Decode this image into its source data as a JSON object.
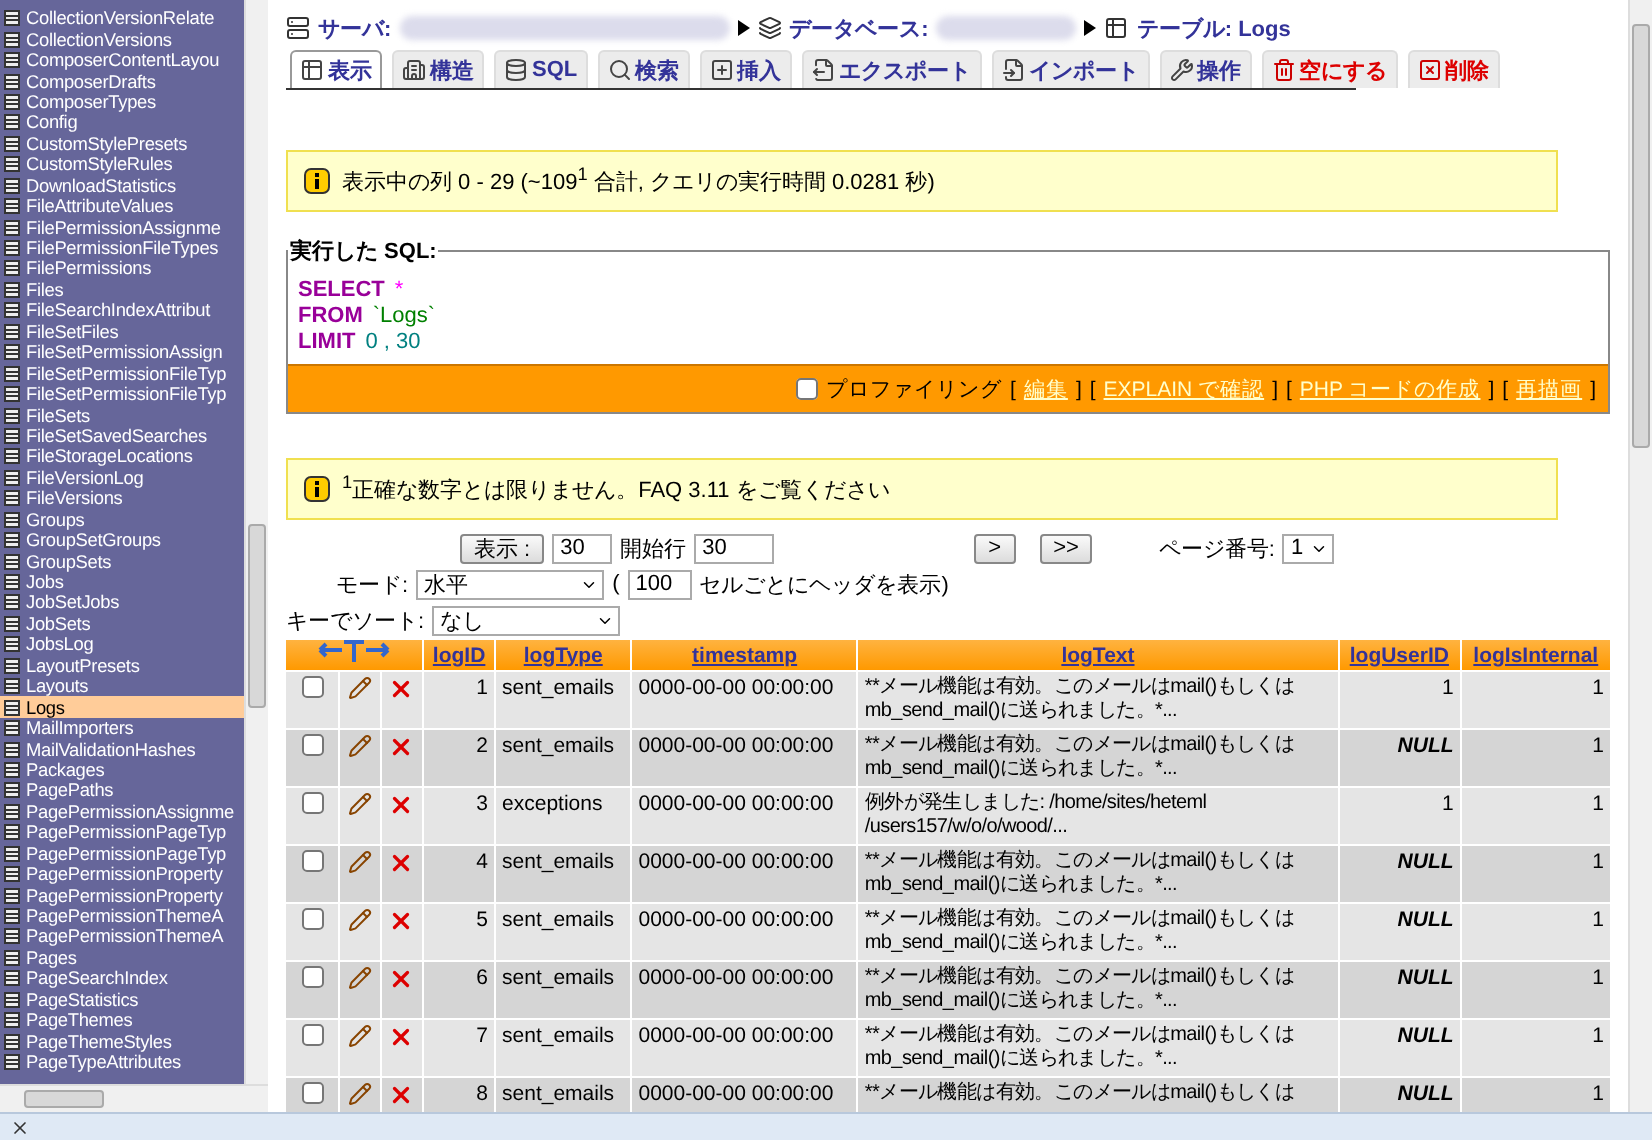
{
  "sidebar": {
    "items": [
      {
        "label": "CollectionVersionRelate",
        "selected": false
      },
      {
        "label": "CollectionVersions",
        "selected": false
      },
      {
        "label": "ComposerContentLayou",
        "selected": false
      },
      {
        "label": "ComposerDrafts",
        "selected": false
      },
      {
        "label": "ComposerTypes",
        "selected": false
      },
      {
        "label": "Config",
        "selected": false
      },
      {
        "label": "CustomStylePresets",
        "selected": false
      },
      {
        "label": "CustomStyleRules",
        "selected": false
      },
      {
        "label": "DownloadStatistics",
        "selected": false
      },
      {
        "label": "FileAttributeValues",
        "selected": false
      },
      {
        "label": "FilePermissionAssignme",
        "selected": false
      },
      {
        "label": "FilePermissionFileTypes",
        "selected": false
      },
      {
        "label": "FilePermissions",
        "selected": false
      },
      {
        "label": "Files",
        "selected": false
      },
      {
        "label": "FileSearchIndexAttribut",
        "selected": false
      },
      {
        "label": "FileSetFiles",
        "selected": false
      },
      {
        "label": "FileSetPermissionAssign",
        "selected": false
      },
      {
        "label": "FileSetPermissionFileTyp",
        "selected": false
      },
      {
        "label": "FileSetPermissionFileTyp",
        "selected": false
      },
      {
        "label": "FileSets",
        "selected": false
      },
      {
        "label": "FileSetSavedSearches",
        "selected": false
      },
      {
        "label": "FileStorageLocations",
        "selected": false
      },
      {
        "label": "FileVersionLog",
        "selected": false
      },
      {
        "label": "FileVersions",
        "selected": false
      },
      {
        "label": "Groups",
        "selected": false
      },
      {
        "label": "GroupSetGroups",
        "selected": false
      },
      {
        "label": "GroupSets",
        "selected": false
      },
      {
        "label": "Jobs",
        "selected": false
      },
      {
        "label": "JobSetJobs",
        "selected": false
      },
      {
        "label": "JobSets",
        "selected": false
      },
      {
        "label": "JobsLog",
        "selected": false
      },
      {
        "label": "LayoutPresets",
        "selected": false
      },
      {
        "label": "Layouts",
        "selected": false
      },
      {
        "label": "Logs",
        "selected": true
      },
      {
        "label": "MailImporters",
        "selected": false
      },
      {
        "label": "MailValidationHashes",
        "selected": false
      },
      {
        "label": "Packages",
        "selected": false
      },
      {
        "label": "PagePaths",
        "selected": false
      },
      {
        "label": "PagePermissionAssignme",
        "selected": false
      },
      {
        "label": "PagePermissionPageTyp",
        "selected": false
      },
      {
        "label": "PagePermissionPageTyp",
        "selected": false
      },
      {
        "label": "PagePermissionProperty",
        "selected": false
      },
      {
        "label": "PagePermissionProperty",
        "selected": false
      },
      {
        "label": "PagePermissionThemeA",
        "selected": false
      },
      {
        "label": "PagePermissionThemeA",
        "selected": false
      },
      {
        "label": "Pages",
        "selected": false
      },
      {
        "label": "PageSearchIndex",
        "selected": false
      },
      {
        "label": "PageStatistics",
        "selected": false
      },
      {
        "label": "PageThemes",
        "selected": false
      },
      {
        "label": "PageThemeStyles",
        "selected": false
      },
      {
        "label": "PageTypeAttributes",
        "selected": false
      }
    ]
  },
  "breadcrumb": [
    {
      "kind": "server",
      "label": "サーバ:",
      "redacted": true
    },
    {
      "kind": "database",
      "label": "データベース:",
      "redacted": true
    },
    {
      "kind": "table",
      "label": "テーブル:",
      "value": "Logs"
    }
  ],
  "tabs": [
    {
      "label": "表示",
      "selected": true,
      "kind": "normal"
    },
    {
      "label": "構造",
      "selected": false,
      "kind": "normal"
    },
    {
      "label": "SQL",
      "selected": false,
      "kind": "normal"
    },
    {
      "label": "検索",
      "selected": false,
      "kind": "normal"
    },
    {
      "label": "挿入",
      "selected": false,
      "kind": "normal"
    },
    {
      "label": "エクスポート",
      "selected": false,
      "kind": "normal"
    },
    {
      "label": "インポート",
      "selected": false,
      "kind": "normal"
    },
    {
      "label": "操作",
      "selected": false,
      "kind": "normal"
    },
    {
      "label": "空にする",
      "selected": false,
      "kind": "danger"
    },
    {
      "label": "削除",
      "selected": false,
      "kind": "danger"
    }
  ],
  "result_notice": "表示中の列 0 - 29 (~109$^{1}$ 合計, クエリの実行時間 0.0281 秒)",
  "sql": {
    "legend": "実行した SQL:",
    "lines": [
      [
        {
          "text": "SELECT",
          "kind": "keyword"
        },
        {
          "text": "*",
          "kind": "operator"
        }
      ],
      [
        {
          "text": "FROM",
          "kind": "keyword"
        },
        {
          "text": "`Logs`",
          "kind": "identifier"
        }
      ],
      [
        {
          "text": "LIMIT",
          "kind": "keyword"
        },
        {
          "text": "0 , 30",
          "kind": "number"
        }
      ]
    ],
    "profiling": {
      "label": "プロファイリング",
      "checked": false
    },
    "links": [
      {
        "open": "[",
        "label": "編集",
        "close": "]"
      },
      {
        "open": "[",
        "label": "EXPLAIN で確認",
        "close": "]"
      },
      {
        "open": "[",
        "label": "PHP コードの作成",
        "close": "]"
      },
      {
        "open": "[",
        "label": "再描画",
        "close": "]"
      }
    ]
  },
  "footnote": "$^{1}$正確な数字とは限りません。FAQ 3.11 をご覧ください",
  "controls": {
    "show_button": "表示 :",
    "rows": "30",
    "start_label": "開始行",
    "start": "30",
    "next_button": ">",
    "last_button": ">>",
    "page_label": "ページ番号:",
    "page": "1",
    "mode_label": "モード:",
    "mode": "水平",
    "paren_open": "(",
    "repeat": "100",
    "repeat_label": "セルごとにヘッダを表示)",
    "sort_label": "キーでソート:",
    "sort": "なし"
  },
  "table": {
    "columns": [
      "logID",
      "logType",
      "timestamp",
      "logText",
      "logUserID",
      "logIsInternal"
    ],
    "rows": [
      {
        "checked": false,
        "id": "1",
        "type": "sent_emails",
        "timestamp": "0000-00-00 00:00:00",
        "text": "**メール機能は有効。このメールはmail()もしくは\nmb_send_mail()に送られました。*...",
        "user_id": "1",
        "user_id_null": false,
        "internal": "1"
      },
      {
        "checked": false,
        "id": "2",
        "type": "sent_emails",
        "timestamp": "0000-00-00 00:00:00",
        "text": "**メール機能は有効。このメールはmail()もしくは\nmb_send_mail()に送られました。*...",
        "user_id": "NULL",
        "user_id_null": true,
        "internal": "1"
      },
      {
        "checked": false,
        "id": "3",
        "type": "exceptions",
        "timestamp": "0000-00-00 00:00:00",
        "text": "例外が発生しました: /home/sites/heteml\n/users157/w/o/o/wood/...",
        "user_id": "1",
        "user_id_null": false,
        "internal": "1"
      },
      {
        "checked": false,
        "id": "4",
        "type": "sent_emails",
        "timestamp": "0000-00-00 00:00:00",
        "text": "**メール機能は有効。このメールはmail()もしくは\nmb_send_mail()に送られました。*...",
        "user_id": "NULL",
        "user_id_null": true,
        "internal": "1"
      },
      {
        "checked": false,
        "id": "5",
        "type": "sent_emails",
        "timestamp": "0000-00-00 00:00:00",
        "text": "**メール機能は有効。このメールはmail()もしくは\nmb_send_mail()に送られました。*...",
        "user_id": "NULL",
        "user_id_null": true,
        "internal": "1"
      },
      {
        "checked": false,
        "id": "6",
        "type": "sent_emails",
        "timestamp": "0000-00-00 00:00:00",
        "text": "**メール機能は有効。このメールはmail()もしくは\nmb_send_mail()に送られました。*...",
        "user_id": "NULL",
        "user_id_null": true,
        "internal": "1"
      },
      {
        "checked": false,
        "id": "7",
        "type": "sent_emails",
        "timestamp": "0000-00-00 00:00:00",
        "text": "**メール機能は有効。このメールはmail()もしくは\nmb_send_mail()に送られました。*...",
        "user_id": "NULL",
        "user_id_null": true,
        "internal": "1"
      },
      {
        "checked": false,
        "id": "8",
        "type": "sent_emails",
        "timestamp": "0000-00-00 00:00:00",
        "text": "**メール機能は有効。このメールはmail()もしくは",
        "user_id": "NULL",
        "user_id_null": true,
        "internal": "1"
      }
    ]
  }
}
